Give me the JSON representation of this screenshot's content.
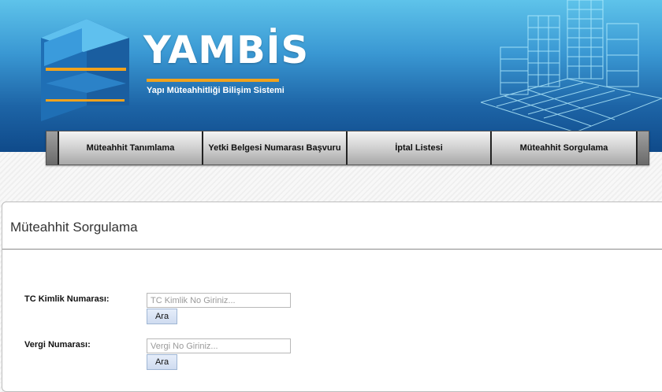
{
  "header": {
    "brand": "YAMBİS",
    "tagline": "Yapı Müteahhitliği Bilişim Sistemi",
    "logo_icon": "building-block-logo",
    "illustration_icon": "wireframe-city-illustration"
  },
  "nav": {
    "items": [
      {
        "label": "Müteahhit Tanımlama"
      },
      {
        "label": "Yetki Belgesi Numarası Başvuru"
      },
      {
        "label": "İptal Listesi"
      },
      {
        "label": "Müteahhit Sorgulama"
      }
    ]
  },
  "panel": {
    "title": "Müteahhit Sorgulama",
    "tc": {
      "label": "TC Kimlik Numarası:",
      "value": "",
      "placeholder": "TC Kimlik No Giriniz...",
      "button": "Ara"
    },
    "vergi": {
      "label": "Vergi Numarası:",
      "value": "",
      "placeholder": "Vergi No Giriniz...",
      "button": "Ara"
    }
  },
  "colors": {
    "header_top": "#5ec3ea",
    "header_bottom": "#0f4a8a",
    "accent_orange": "#f2a21c",
    "button_bg": "#dbe6f6"
  }
}
